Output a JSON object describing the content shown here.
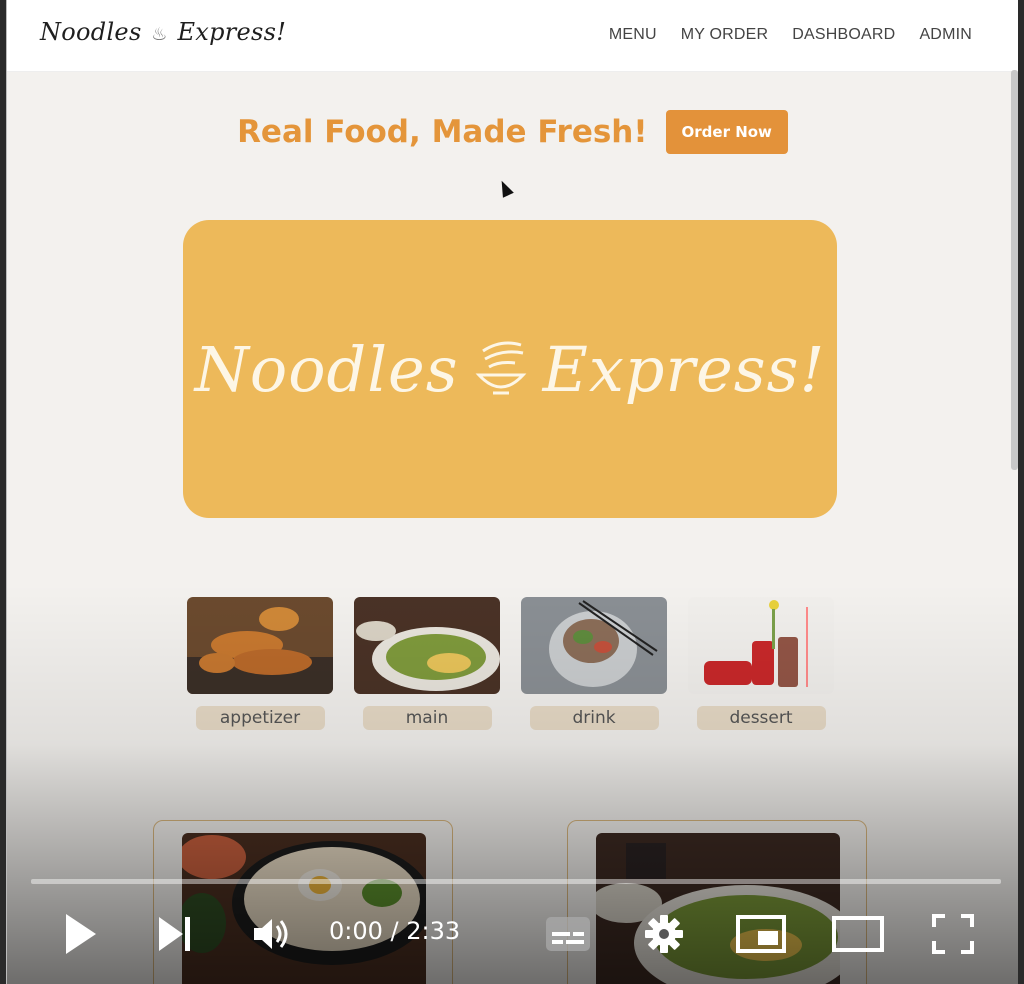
{
  "app": {
    "brand_left": "Noodles",
    "brand_right": "Express!"
  },
  "nav": {
    "items": [
      "MENU",
      "MY ORDER",
      "DASHBOARD",
      "ADMIN"
    ]
  },
  "hero": {
    "tagline": "Real Food, Made Fresh!",
    "order_button": "Order Now"
  },
  "banner": {
    "left": "Noodles",
    "right": "Express!"
  },
  "categories": [
    {
      "label": "appetizer",
      "icon": "fried-chicken-photo"
    },
    {
      "label": "main",
      "icon": "noodle-bowl-photo"
    },
    {
      "label": "drink",
      "icon": "salad-plate-photo"
    },
    {
      "label": "dessert",
      "icon": "cola-cans-photo"
    }
  ],
  "video": {
    "time": "0:00 / 2:33",
    "progress_fraction": 0.0
  },
  "colors": {
    "accent": "#e4953a",
    "banner": "#edb95a",
    "chip": "#e7dac6",
    "background": "#f3f1ee"
  }
}
